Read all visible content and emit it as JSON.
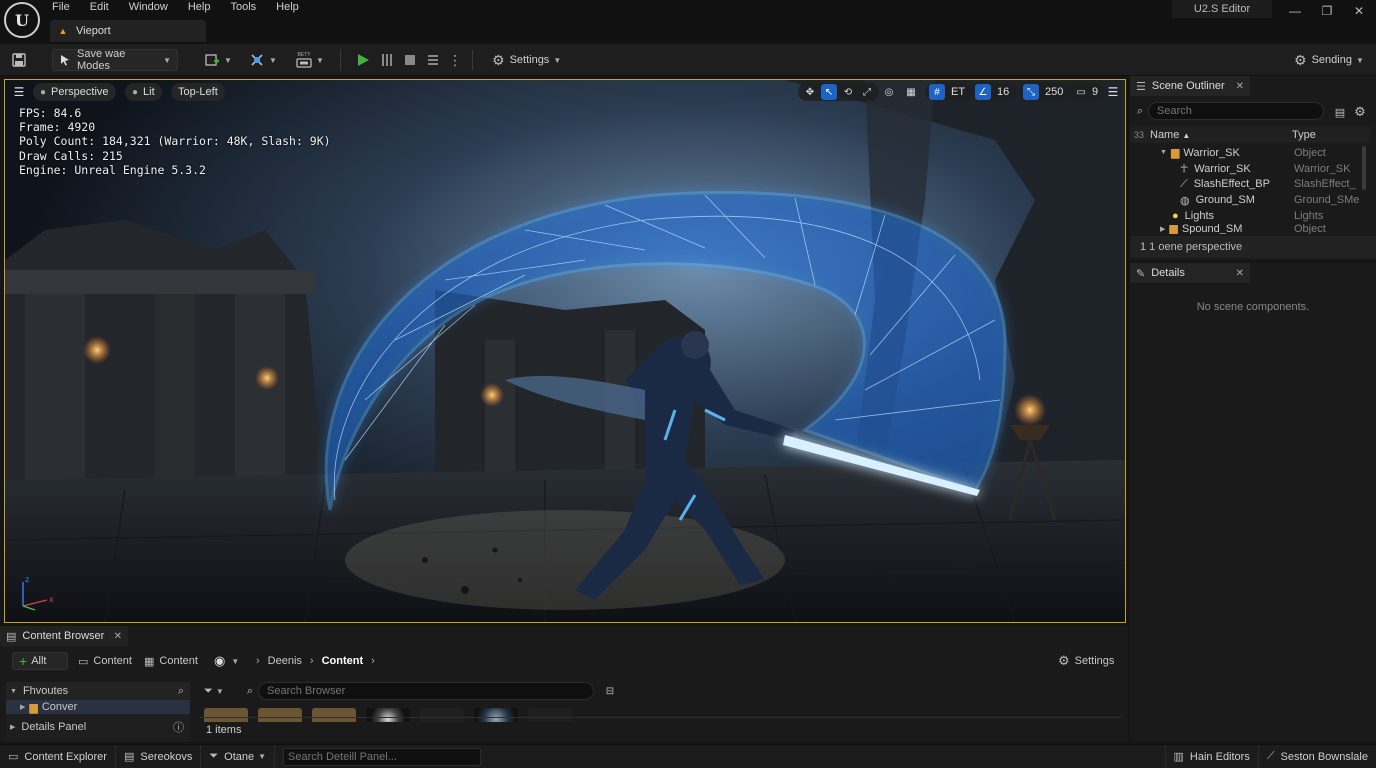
{
  "menu": [
    "File",
    "Edit",
    "Window",
    "Help",
    "Tools",
    "Help"
  ],
  "document_tab": "Vieport",
  "app_title": "U2.S Editor",
  "toolbar": {
    "modes_label": "Save wae Modes",
    "platform_badge": "BETY",
    "settings_label": "Settings",
    "right_label": "Sending"
  },
  "viewport": {
    "perspective_label": "Perspective",
    "lit_label": "Lit",
    "layout_label": "Top-Left",
    "stats": {
      "fps": "FPS: 84.6",
      "frame": "Frame: 4920",
      "poly": "Poly Count: 184,321 (Warrior: 48K, Slash: 9K)",
      "draw": "Draw Calls: 215",
      "engine": "Engine: Unreal Engine 5.3.2"
    },
    "toolbar_right": {
      "et_label": "ET",
      "snap_value": "16",
      "speed_value": "250",
      "cam_value": "9"
    }
  },
  "outliner": {
    "title": "Scene Outliner",
    "search_placeholder": "Search",
    "count": "33",
    "col_name": "Name",
    "col_type": "Type",
    "rows": [
      {
        "name": "Warrior_SK",
        "type": "Object"
      },
      {
        "name": "Warrior_SK",
        "type": "Warrior_SK"
      },
      {
        "name": "SlashEffect_BP",
        "type": "SlashEffect_"
      },
      {
        "name": "Ground_SM",
        "type": "Ground_SMe"
      },
      {
        "name": "Lights",
        "type": "Lights"
      },
      {
        "name": "Spound_SM",
        "type": "Object"
      }
    ],
    "footer": "1 1 oene perspective"
  },
  "details": {
    "title": "Details",
    "empty_text": "No scene components."
  },
  "content_browser": {
    "title": "Content Browser",
    "add_label": "Allt",
    "content_btn_1": "Content",
    "content_btn_2": "Content",
    "crumb_1": "Deenis",
    "crumb_2": "Content",
    "settings_label": "Settings",
    "favourites": "Fhvoutes",
    "folder": "Conver",
    "details_panel": "Details Panel",
    "search_placeholder": "Search Browser",
    "items_count": "1 items"
  },
  "statusbar": {
    "content_explorer": "Content Explorer",
    "sequences": "Sereokovs",
    "output": "Otane",
    "search_placeholder": "Search Deteill Panel...",
    "main_editors": "Hain Editors",
    "session": "Seston Bownslale"
  },
  "colors": {
    "accent_blue": "#1e63c4",
    "viewport_border": "#c9a227",
    "play_green": "#3fb23f",
    "slash_glow": "#3aa0ff"
  }
}
